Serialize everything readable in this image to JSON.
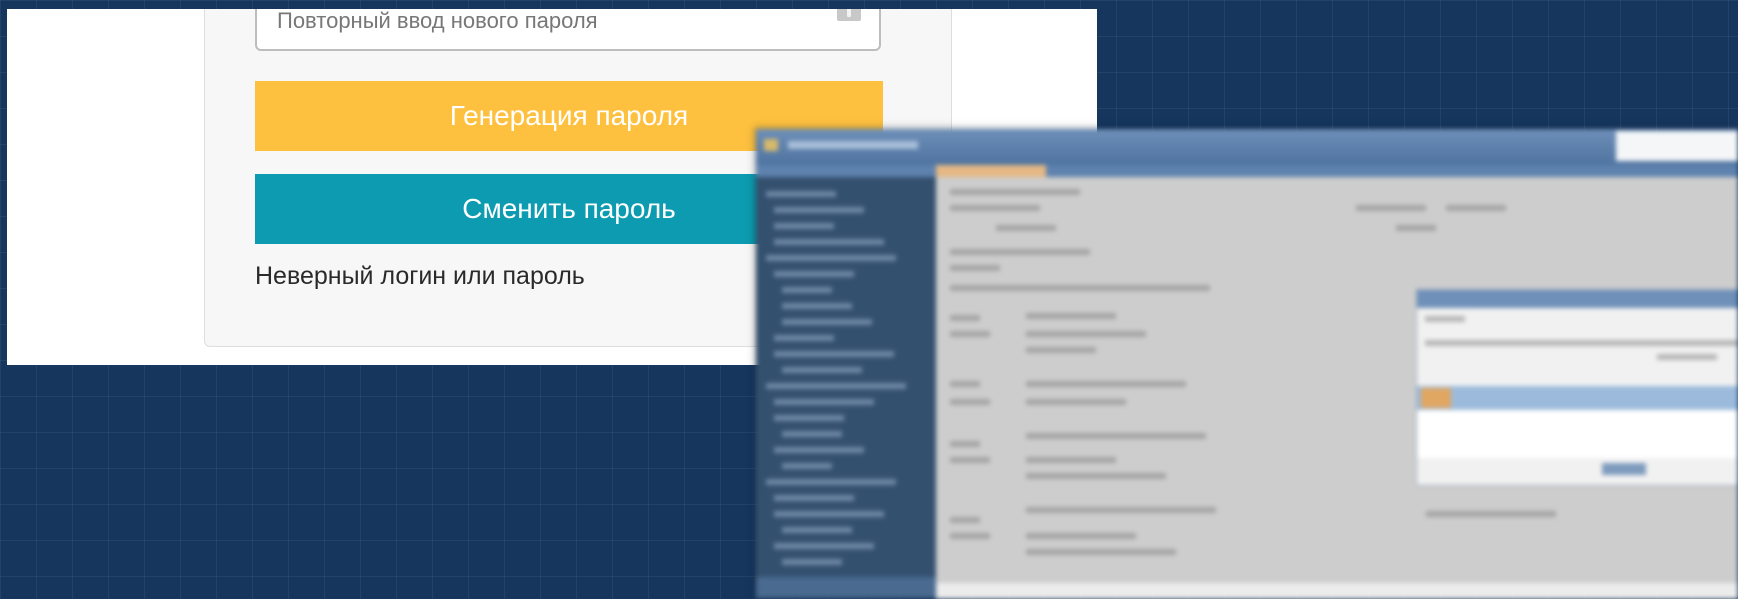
{
  "form": {
    "repeat_password_placeholder": "Повторный ввод нового пароля",
    "generate_button_label": "Генерация пароля",
    "change_button_label": "Сменить пароль",
    "error_message": "Неверный логин или пароль"
  },
  "colors": {
    "background": "#16365e",
    "generate_button": "#fdc13f",
    "change_button": "#0c9bb0",
    "card": "#f7f7f7"
  },
  "icons": {
    "password_field_icon": "key-icon"
  }
}
